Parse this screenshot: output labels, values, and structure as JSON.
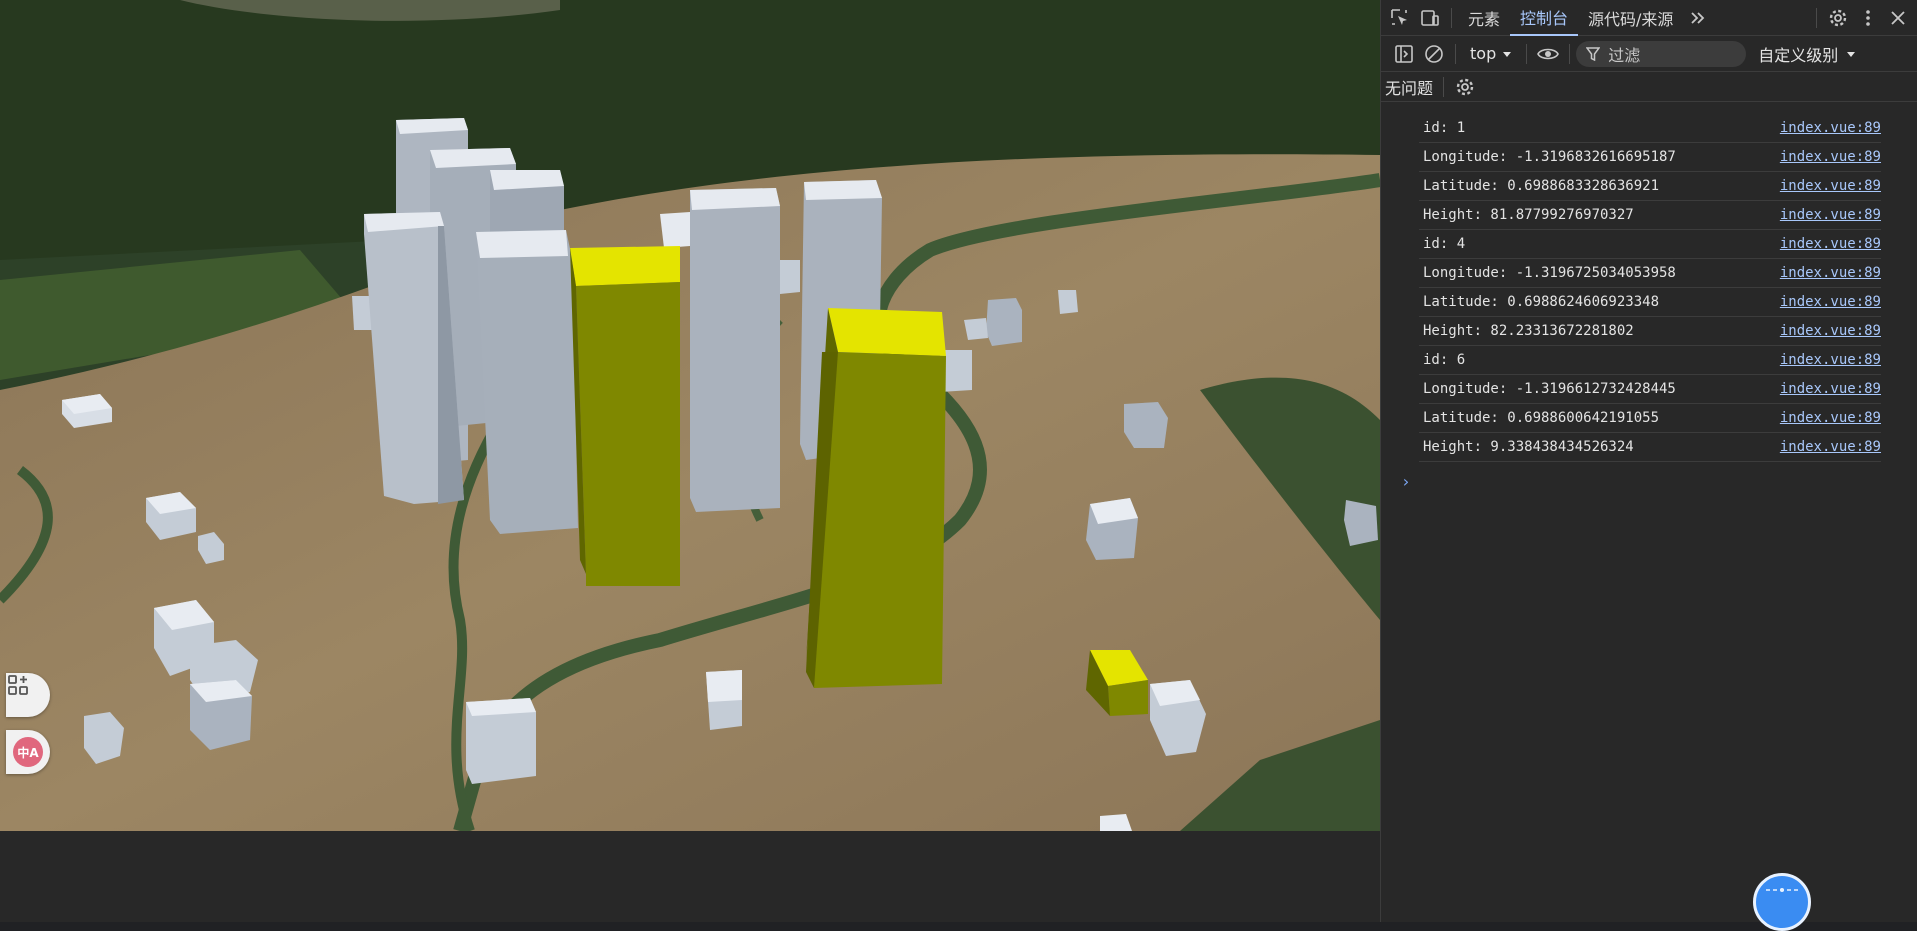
{
  "devtools": {
    "tabs": [
      {
        "label": "元素",
        "active": false
      },
      {
        "label": "控制台",
        "active": true
      },
      {
        "label": "源代码/来源",
        "active": false
      }
    ],
    "context": "top",
    "filter_placeholder": "过滤",
    "level": "自定义级别",
    "issues": "无问题",
    "logs": [
      {
        "text": "id: 1",
        "source": "index.vue:89"
      },
      {
        "text": "Longitude: -1.3196832616695187",
        "source": "index.vue:89"
      },
      {
        "text": "Latitude: 0.6988683328636921",
        "source": "index.vue:89"
      },
      {
        "text": "Height: 81.87799276970327",
        "source": "index.vue:89"
      },
      {
        "text": "id: 4",
        "source": "index.vue:89"
      },
      {
        "text": "Longitude: -1.3196725034053958",
        "source": "index.vue:89"
      },
      {
        "text": "Latitude: 0.6988624606923348",
        "source": "index.vue:89"
      },
      {
        "text": "Height: 82.23313672281802",
        "source": "index.vue:89"
      },
      {
        "text": "id: 6",
        "source": "index.vue:89"
      },
      {
        "text": "Longitude: -1.3196612732428445",
        "source": "index.vue:89"
      },
      {
        "text": "Latitude: 0.6988600642191055",
        "source": "index.vue:89"
      },
      {
        "text": "Height: 9.338438434526324",
        "source": "index.vue:89"
      }
    ],
    "prompt_symbol": "›"
  },
  "viewport": {
    "highlight_color": "#e4e400",
    "building_color": "#c9d0d8"
  },
  "side_buttons": {
    "translate_label": "中A"
  }
}
